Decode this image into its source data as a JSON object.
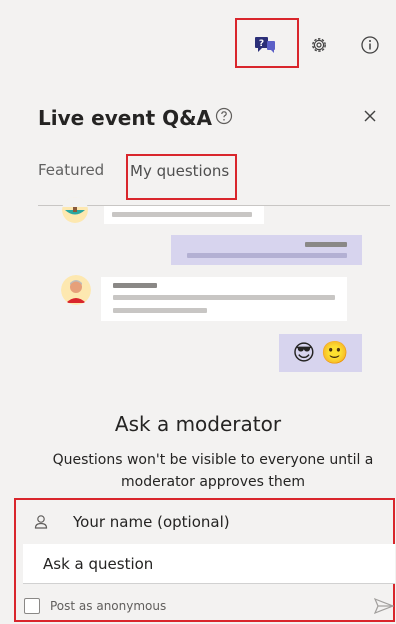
{
  "toolbar": {
    "qa_icon": "qa-chat-icon",
    "settings_icon": "gear-icon",
    "info_icon": "info-icon"
  },
  "panel": {
    "title": "Live event Q&A",
    "help_icon": "help-circle-icon",
    "close_icon": "close-icon"
  },
  "tabs": [
    {
      "label": "Featured",
      "selected": false
    },
    {
      "label": "My questions",
      "selected": true
    }
  ],
  "empty_state": {
    "heading": "Ask a moderator",
    "description": "Questions won't be visible to everyone until a moderator approves them",
    "emojis": [
      "😎",
      "🙂"
    ]
  },
  "form": {
    "name_placeholder": "Your name (optional)",
    "question_placeholder": "Ask a question",
    "anonymous_label": "Post as anonymous",
    "anonymous_checked": false,
    "name_icon": "person-icon",
    "send_icon": "send-icon"
  },
  "colors": {
    "highlight": "#d9262c",
    "accent": "#6264a7",
    "own_bubble": "#d7d4ee"
  }
}
